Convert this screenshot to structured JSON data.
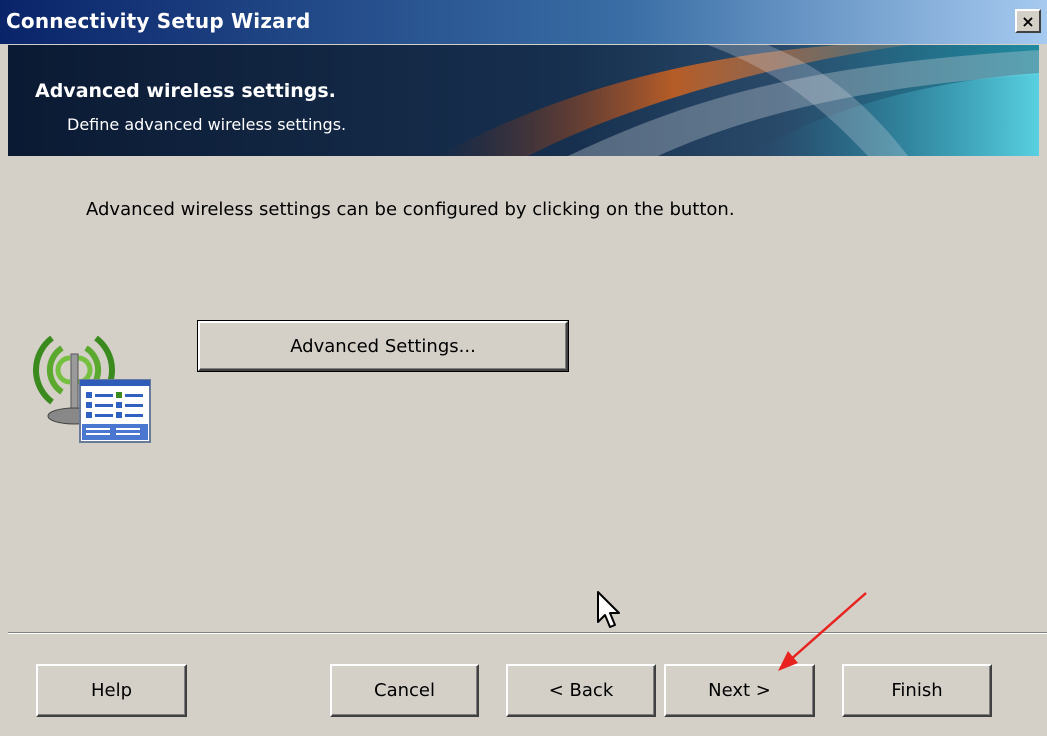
{
  "window": {
    "title": "Connectivity Setup Wizard",
    "close_glyph": "×"
  },
  "banner": {
    "title": "Advanced wireless settings.",
    "subtitle": "Define advanced wireless settings."
  },
  "content": {
    "description": "Advanced wireless settings can be configured by clicking on the button.",
    "advanced_button_label": "Advanced Settings...",
    "icon": "wireless-settings-icon"
  },
  "footer": {
    "help_label": "Help",
    "cancel_label": "Cancel",
    "back_label": "< Back",
    "next_label": "Next >",
    "finish_label": "Finish"
  },
  "colors": {
    "face": "#d4d0c8",
    "titlebar_start": "#0a246a",
    "annotation_arrow": "#e8231f",
    "wifi_green": "#3a8a1e"
  }
}
